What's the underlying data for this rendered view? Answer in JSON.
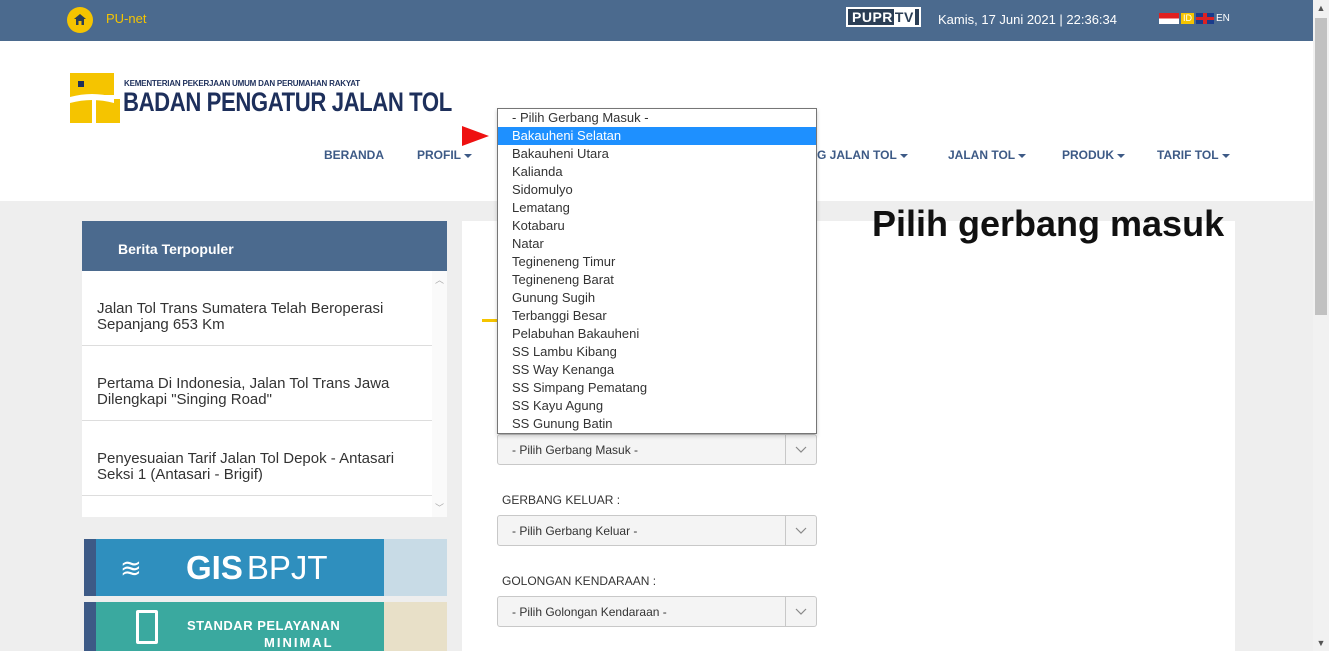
{
  "topbar": {
    "brand": "PU-net",
    "puprtv_left": "PUPR",
    "puprtv_right": "TV",
    "datetime": "Kamis, 17 Juni 2021 | 22:36:34",
    "lang_id": "ID",
    "lang_en": "EN"
  },
  "logo": {
    "ministry": "KEMENTERIAN PEKERJAAN UMUM DAN PERUMAHAN RAKYAT",
    "agency": "BADAN PENGATUR JALAN TOL",
    "colors": {
      "yellow": "#f5c400",
      "navy": "#1d2f5b"
    }
  },
  "nav": {
    "items": [
      {
        "label": "BERANDA",
        "has_caret": false
      },
      {
        "label": "PROFIL",
        "has_caret": true
      },
      {
        "label": "G JALAN TOL",
        "has_caret": true
      },
      {
        "label": "JALAN TOL",
        "has_caret": true
      },
      {
        "label": "PRODUK",
        "has_caret": true
      },
      {
        "label": "TARIF TOL",
        "has_caret": true
      }
    ]
  },
  "sidebar": {
    "title": "Berita Terpopuler",
    "news": [
      {
        "line1": "Jalan Tol Trans Sumatera Telah Beroperasi",
        "line2": "Sepanjang 653 Km"
      },
      {
        "line1": "Pertama Di Indonesia, Jalan Tol Trans Jawa",
        "line2": "Dilengkapi \"Singing Road\""
      },
      {
        "line1": "Penyesuaian Tarif Jalan Tol Depok - Antasari",
        "line2": "Seksi 1 (Antasari - Brigif)"
      }
    ]
  },
  "banners": {
    "gis_bold": "GIS",
    "gis_light": "BPJT",
    "spm_line1": "STANDAR PELAYANAN",
    "spm_line2": "MINIMAL"
  },
  "form": {
    "entry_select_value": "- Pilih Gerbang Masuk -",
    "exit_label": "GERBANG KELUAR :",
    "exit_select_value": "- Pilih Gerbang Keluar -",
    "vehicle_label": "GOLONGAN KENDARAAN :",
    "vehicle_select_value": "- Pilih Golongan Kendaraan -"
  },
  "dropdown": {
    "selected_index": 1,
    "options": [
      "- Pilih Gerbang Masuk -",
      "Bakauheni Selatan",
      "Bakauheni Utara",
      "Kalianda",
      "Sidomulyo",
      "Lematang",
      "Kotabaru",
      "Natar",
      "Tegineneng Timur",
      "Tegineneng Barat",
      "Gunung Sugih",
      "Terbanggi Besar",
      "Pelabuhan Bakauheni",
      "SS Lambu Kibang",
      "SS Way Kenanga",
      "SS Simpang Pematang",
      "SS Kayu Agung",
      "SS Gunung Batin"
    ],
    "highlight_color": "#1e90ff"
  },
  "annotation": {
    "text": "Pilih gerbang masuk",
    "arrow_color": "#ee1111"
  },
  "colors": {
    "topbar": "#4b6a8e",
    "band": "#eeeeee",
    "nav_text": "#3d5a86"
  }
}
